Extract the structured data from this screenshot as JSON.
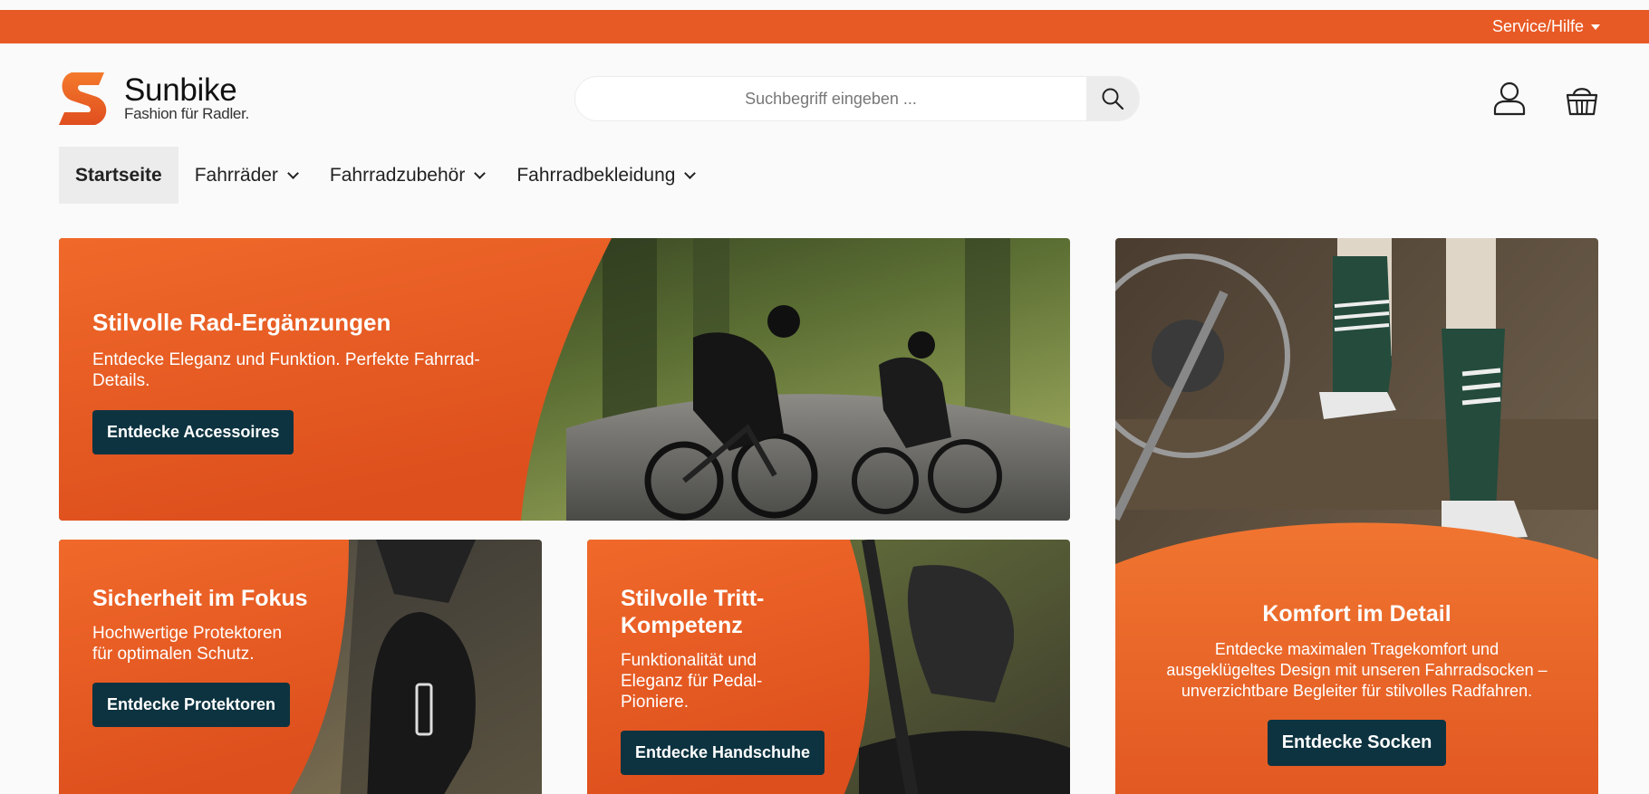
{
  "topbar": {
    "service_label": "Service/Hilfe",
    "background": "#e85a25"
  },
  "header": {
    "logo_name": "Sunbike",
    "logo_tagline": "Fashion für Radler.",
    "search_placeholder": "Suchbegriff eingeben ...",
    "icons": [
      "search-icon",
      "account-icon",
      "basket-icon"
    ]
  },
  "nav": {
    "items": [
      {
        "label": "Startseite"
      },
      {
        "label": "Fahrräder"
      },
      {
        "label": "Fahrradzubehör"
      },
      {
        "label": "Fahrradbekleidung"
      }
    ]
  },
  "colors": {
    "accent": "#e85a25",
    "button": "#0d3340"
  },
  "banners": {
    "main": {
      "title": "Stilvolle Rad-Ergänzungen",
      "text": "Entdecke Eleganz und Funktion. Perfekte Fahrrad-Details.",
      "button": "Entdecke Accessoires"
    },
    "protectors": {
      "title": "Sicherheit im Fokus",
      "text": "Hochwertige Protektoren für optimalen Schutz.",
      "button": "Entdecke Protektoren"
    },
    "gloves": {
      "title": "Stilvolle Tritt-Kompetenz",
      "text": "Funktionalität und Eleganz für Pedal-Pioniere.",
      "button": "Entdecke Handschuhe"
    },
    "socks": {
      "title": "Komfort im Detail",
      "text": "Entdecke maximalen Tragekomfort und ausgeklügeltes Design mit unseren Fahrradsocken – unverzichtbare Begleiter für stilvolles Radfahren.",
      "button": "Entdecke Socken"
    }
  }
}
